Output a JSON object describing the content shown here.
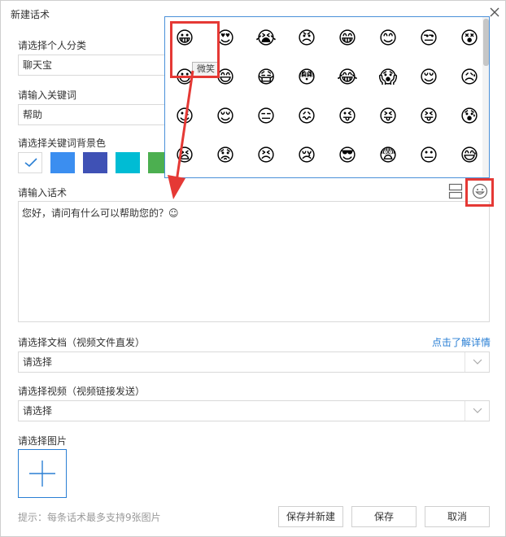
{
  "window": {
    "title": "新建话术"
  },
  "category": {
    "label": "请选择个人分类",
    "value": "聊天宝"
  },
  "keyword": {
    "label": "请输入关键词",
    "value": "帮助"
  },
  "color": {
    "label": "请选择关键词背景色",
    "swatches": [
      "#ffffff",
      "#3b8ef0",
      "#3f51b5",
      "#00bcd4",
      "#4caf50"
    ]
  },
  "script": {
    "label": "请输入话术",
    "value": "您好，请问有什么可以帮助您的？☺"
  },
  "document": {
    "label": "请选择文档（视频文件直发）",
    "value": "请选择",
    "link": "点击了解详情"
  },
  "video": {
    "label": "请选择视频（视频链接发送）",
    "value": "请选择"
  },
  "image": {
    "label": "请选择图片"
  },
  "hint": "提示：每条话术最多支持9张图片",
  "buttons": {
    "save_new": "保存并新建",
    "save": "保存",
    "cancel": "取消"
  },
  "emoji_panel": {
    "tooltip": "微笑",
    "emojis": [
      "😀",
      "😍",
      "😭",
      "😠",
      "😁",
      "😊",
      "😒",
      "😵",
      "😃",
      "😄",
      "😷",
      "😳",
      "😂",
      "😱",
      "😌",
      "😥",
      "😉",
      "😌",
      "😑",
      "😖",
      "😜",
      "😝",
      "😝",
      "😰",
      "😫",
      "😟",
      "😣",
      "😢",
      "😎",
      "😨",
      "😐",
      "😅"
    ]
  },
  "icons": {
    "close": "close-icon",
    "layout": "split-layout-icon",
    "emoji": "smiley-icon",
    "dropdown": "chevron-down-icon",
    "plus": "plus-icon",
    "check": "check-icon"
  },
  "colors": {
    "accent": "#2a7fd4",
    "highlight": "#e53935"
  }
}
